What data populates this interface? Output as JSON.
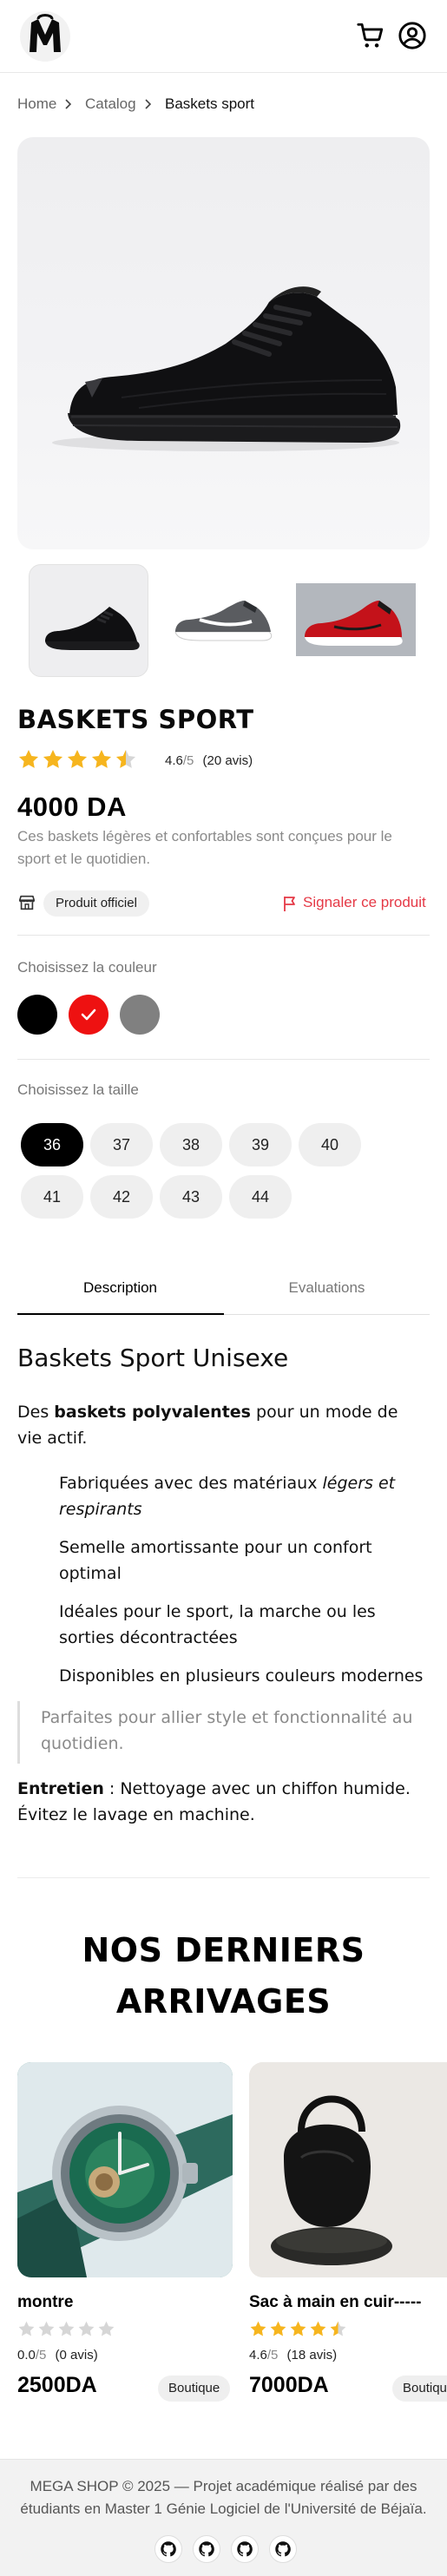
{
  "header": {
    "cart_icon": "cart-icon",
    "account_icon": "user-circle-icon",
    "logo": "mega-shop-logo"
  },
  "breadcrumb": {
    "home": "Home",
    "catalog": "Catalog",
    "current": "Baskets sport"
  },
  "product": {
    "title": "BASKETS SPORT",
    "rating_value": "4.6",
    "rating_max": "/5",
    "rating_count": "(20 avis)",
    "stars_filled": 4.5,
    "price": "4000 DA",
    "short_description": "Ces baskets légères et confortables sont conçues pour le sport et le quotidien.",
    "official_badge": "Produit officiel",
    "report_label": "Signaler ce produit",
    "thumbnails": [
      "black-sneaker",
      "grey-sneaker",
      "red-sneaker"
    ]
  },
  "colors": {
    "label": "Choisissez la couleur",
    "swatches": [
      {
        "name": "black",
        "hex": "#000000",
        "selected": false
      },
      {
        "name": "red",
        "hex": "#ee1111",
        "selected": true
      },
      {
        "name": "grey",
        "hex": "#808080",
        "selected": false
      }
    ]
  },
  "sizes": {
    "label": "Choisissez la taille",
    "options": [
      "36",
      "37",
      "38",
      "39",
      "40",
      "41",
      "42",
      "43",
      "44"
    ],
    "selected": "36"
  },
  "tabs": {
    "description": "Description",
    "evaluations": "Evaluations"
  },
  "article": {
    "heading": "Baskets Sport Unisexe",
    "intro_1": "Des ",
    "intro_bold": "baskets polyvalentes",
    "intro_2": " pour un mode de vie actif.",
    "bullet_1a": "Fabriquées avec des matériaux ",
    "bullet_1_italic": "légers et respirants",
    "bullet_2": "Semelle amortissante pour un confort optimal",
    "bullet_3": "Idéales pour le sport, la marche ou les sorties décontractées",
    "bullet_4": "Disponibles en plusieurs couleurs modernes",
    "quote": "Parfaites pour allier style et fonctionnalité au quotidien.",
    "care_bold": "Entretien",
    "care_text": " : Nettoyage avec un chiffon humide. Évitez le lavage en machine."
  },
  "arrivals": {
    "title_line1": "NOS DERNIERS",
    "title_line2": "ARRIVAGES",
    "cards": [
      {
        "name": "montre",
        "rating_value": "0.0",
        "rating_max": "/5",
        "rating_count": "(0 avis)",
        "stars_filled": 0,
        "price": "2500DA",
        "badge": "Boutique",
        "image": "green-watch"
      },
      {
        "name": "Sac à main en cuir-----",
        "rating_value": "4.6",
        "rating_max": "/5",
        "rating_count": "(18 avis)",
        "stars_filled": 4.5,
        "price": "7000DA",
        "badge": "Boutique",
        "image": "black-handbag"
      }
    ]
  },
  "footer": {
    "text": "MEGA SHOP © 2025 — Projet académique réalisé par des étudiants en Master 1 Génie Logiciel de l'Université de Béjaïa.",
    "icons": [
      "github-icon",
      "github-icon",
      "github-icon",
      "github-icon"
    ]
  },
  "theme": {
    "star": "#f6b51e",
    "star_empty": "#d6d6d6",
    "report": "#e53946",
    "accent": "#000000"
  }
}
